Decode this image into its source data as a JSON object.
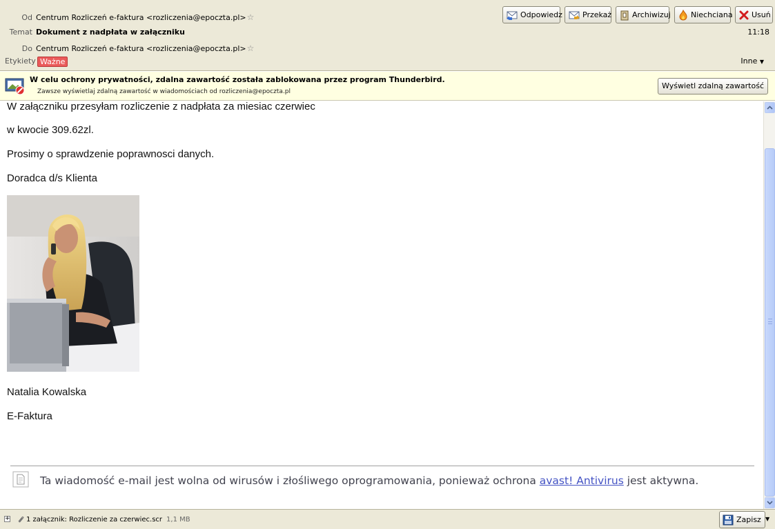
{
  "header": {
    "from_label": "Od",
    "from_value": "Centrum Rozliczeń e-faktura <rozliczenia@epoczta.pl>",
    "subject_label": "Temat",
    "subject_value": "Dokument z nadpłata w załączniku",
    "to_label": "Do",
    "to_value": "Centrum Rozliczeń e-faktura <rozliczenia@epoczta.pl>",
    "tags_label": "Etykiety",
    "tag": "Ważne",
    "time": "11:18",
    "other_label": "Inne",
    "buttons": {
      "reply": "Odpowiedz",
      "forward": "Przekaż",
      "archive": "Archiwizuj",
      "junk": "Niechciana",
      "delete": "Usuń"
    }
  },
  "remote_bar": {
    "message": "W celu ochrony prywatności, zdalna zawartość została zablokowana przez program Thunderbird.",
    "option": "Zawsze wyświetlaj zdalną zawartość w wiadomościach od rozliczenia@epoczta.pl",
    "button": "Wyświetl zdalną zawartość"
  },
  "body": {
    "lines": [
      "W załączniku przesyłam rozliczenie z nadpłata za miesiac czerwiec",
      "w kwocie 309.62zl.",
      "Prosimy o sprawdzenie poprawnosci danych.",
      "Doradca d/s Klienta"
    ],
    "signature_name": "Natalia Kowalska",
    "signature_company": "E-Faktura",
    "avast": {
      "before": "Ta wiadomość e-mail jest wolna od wirusów i złośliwego oprogramowania, ponieważ ochrona ",
      "link": "avast! Antivirus",
      "after": " jest aktywna."
    }
  },
  "attachment_bar": {
    "expand": "+",
    "text": "1 załącznik: Rozliczenie za czerwiec.scr",
    "size": "1,1 MB",
    "save_button": "Zapisz",
    "save_menu": "▼"
  },
  "icons": {
    "reply": "envelope-reply-icon",
    "forward": "envelope-forward-icon",
    "archive": "archive-box-icon",
    "junk": "flame-icon",
    "delete": "red-x-icon",
    "remote": "blocked-image-icon",
    "attachment": "paperclip-icon",
    "save": "floppy-disk-icon"
  },
  "colors": {
    "header_bg": "#ece9d8",
    "remote_bar_bg": "#ffffe1",
    "tag_bg": "#ea5a5a",
    "link": "#4453c4",
    "scrollbar_thumb": "#b6cbf8"
  }
}
